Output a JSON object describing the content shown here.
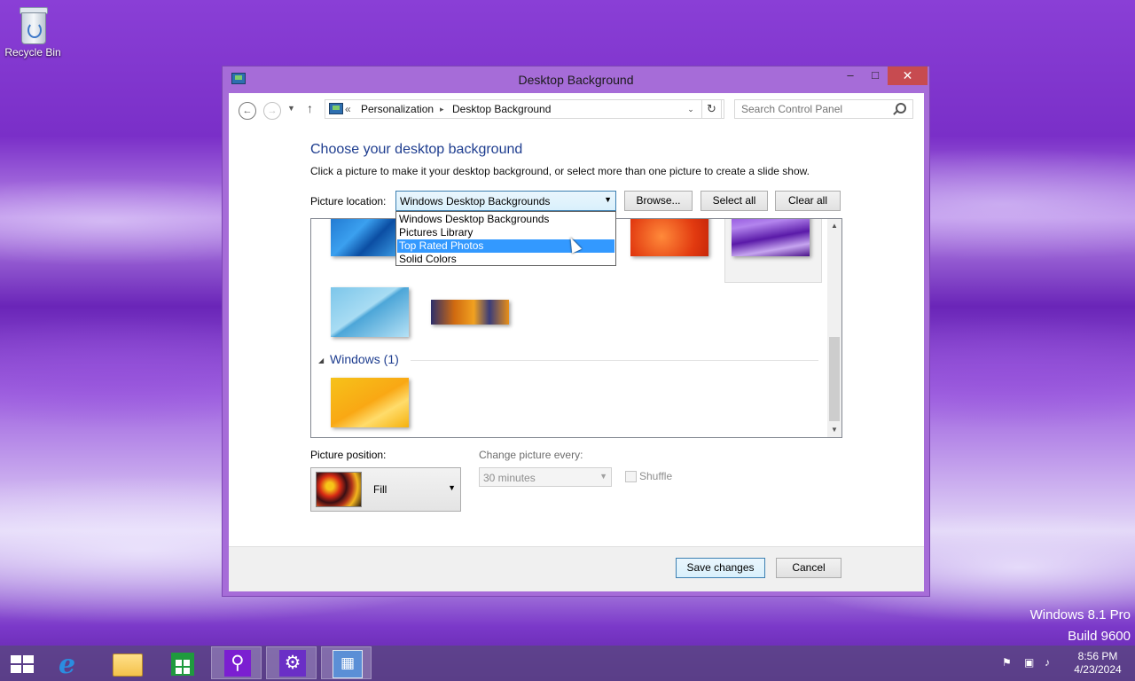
{
  "desktop": {
    "recycle_bin_label": "Recycle Bin"
  },
  "window": {
    "title": "Desktop Background",
    "min_glyph": "–",
    "max_glyph": "□",
    "close_glyph": "✕"
  },
  "nav": {
    "back_glyph": "←",
    "fwd_glyph": "→",
    "recent_glyph": "▼",
    "up_glyph": "↑",
    "breadcrumb_prefix": "«",
    "breadcrumbs": [
      "Personalization",
      "Desktop Background"
    ],
    "breadcrumb_sep": "▸",
    "dropdown_glyph": "⌄",
    "refresh_glyph": "↻",
    "search_placeholder": "Search Control Panel"
  },
  "content": {
    "heading": "Choose your desktop background",
    "instructions": "Click a picture to make it your desktop background, or select more than one picture to create a slide show.",
    "picture_location_label": "Picture location:",
    "picture_location_value": "Windows Desktop Backgrounds",
    "browse_label": "Browse...",
    "select_all_label": "Select all",
    "clear_all_label": "Clear all",
    "location_options": [
      "Windows Desktop Backgrounds",
      "Pictures Library",
      "Top Rated Photos",
      "Solid Colors"
    ],
    "highlighted_option": "Top Rated Photos",
    "group_title": "Windows (1)",
    "picture_position_label": "Picture position:",
    "picture_position_value": "Fill",
    "change_picture_label": "Change picture every:",
    "change_picture_value": "30 minutes",
    "shuffle_label": "Shuffle",
    "shuffle_checked": false,
    "save_label": "Save changes",
    "cancel_label": "Cancel"
  },
  "watermark": {
    "line1": "Windows 8.1 Pro",
    "line2": "Build 9600"
  },
  "taskbar": {
    "apps": [
      "start-icon",
      "internet-explorer-icon",
      "file-explorer-icon",
      "store-icon",
      "search-icon",
      "settings-icon",
      "control-panel-icon"
    ],
    "clock_time": "8:56 PM",
    "clock_date": "4/23/2024"
  },
  "colors": {
    "accent": "#a66cd8",
    "close": "#c74b50",
    "selection": "#3399ff",
    "heading": "#1e3d8f"
  }
}
